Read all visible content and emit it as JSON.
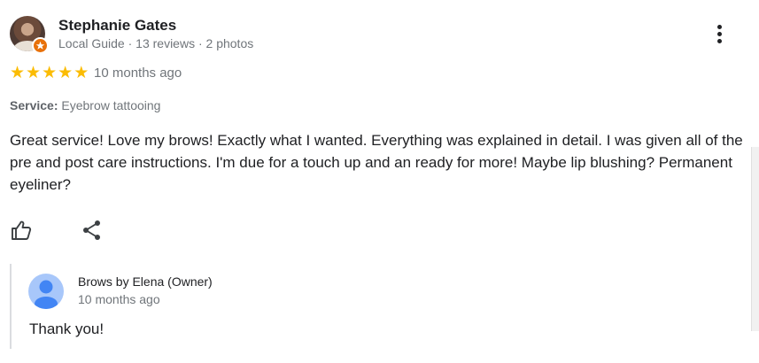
{
  "review": {
    "author": {
      "name": "Stephanie Gates",
      "meta": "Local Guide · 13 reviews · 2 photos",
      "avatar_icon": "user-photo-avatar",
      "badge_icon": "local-guide-badge-icon",
      "badge_color": "#e8710a"
    },
    "menu_icon": "more-vert-icon",
    "rating": {
      "value": 5,
      "max": 5,
      "star_glyph": "★",
      "star_color": "#fbbc04"
    },
    "time": "10 months ago",
    "service": {
      "label": "Service:",
      "value": "Eyebrow tattooing"
    },
    "text": "Great service! Love my brows! Exactly what I wanted. Everything was explained in detail. I was given all of the pre and post care instructions. I'm due for a touch up and an ready for more! Maybe lip blushing? Permanent eyeliner?",
    "actions": {
      "like_icon": "thumb-up-icon",
      "share_icon": "share-icon"
    }
  },
  "owner_reply": {
    "name": "Brows by Elena (Owner)",
    "time": "10 months ago",
    "text": "Thank you!",
    "avatar_icon": "default-user-avatar",
    "avatar_color": "#a8c7fa",
    "avatar_figure_color": "#4285f4"
  }
}
